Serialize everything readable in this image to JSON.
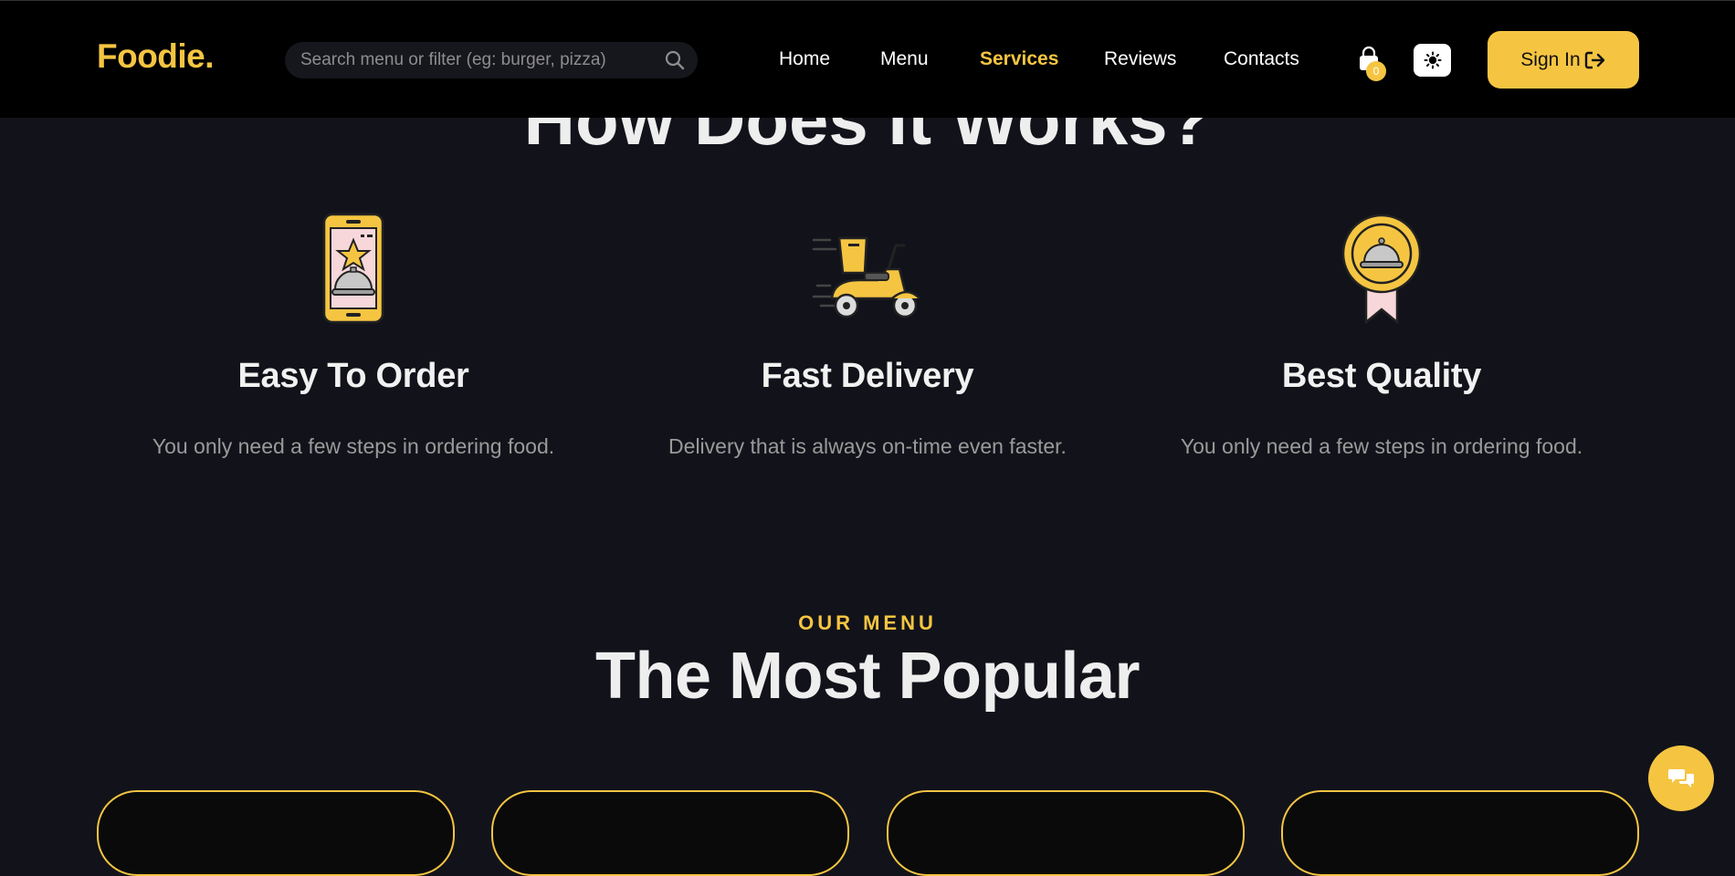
{
  "brand": {
    "logo": "Foodie.",
    "accent_color": "#f5c542"
  },
  "search": {
    "placeholder": "Search menu or filter (eg: burger, pizza)",
    "icon": "search-icon"
  },
  "nav": {
    "items": [
      {
        "label": "Home",
        "active": false
      },
      {
        "label": "Menu",
        "active": false
      },
      {
        "label": "Services",
        "active": true
      },
      {
        "label": "Reviews",
        "active": false
      },
      {
        "label": "Contacts",
        "active": false
      }
    ]
  },
  "cart": {
    "icon": "shopping-bag-icon",
    "count": "0"
  },
  "theme_toggle": {
    "icon": "sun-icon"
  },
  "signin": {
    "label": "Sign In",
    "icon": "sign-in-icon"
  },
  "how_it_works": {
    "title": "How Does It Works?",
    "features": [
      {
        "icon": "phone-order-icon",
        "title": "Easy To Order",
        "text": "You only need a few steps in ordering food."
      },
      {
        "icon": "delivery-scooter-icon",
        "title": "Fast Delivery",
        "text": "Delivery that is always on-time even faster."
      },
      {
        "icon": "quality-badge-icon",
        "title": "Best Quality",
        "text": "You only need a few steps in ordering food."
      }
    ]
  },
  "menu": {
    "eyebrow": "OUR MENU",
    "title": "The Most Popular",
    "card_count": 4
  },
  "chat": {
    "icon": "chat-icon"
  }
}
